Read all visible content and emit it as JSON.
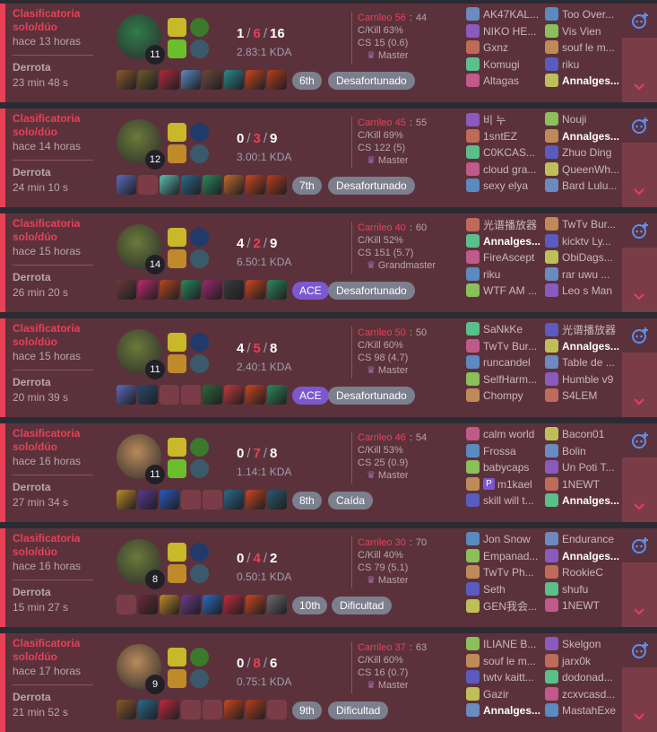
{
  "colors": {
    "loss": "#e84057",
    "loss_bg": "#5b323b",
    "chip": "#7c7f8d",
    "ace": "#7b58d0"
  },
  "matches": [
    {
      "queue": "Clasificatoria solo/dúo",
      "ago": "hace 13 horas",
      "result": "Derrota",
      "duration": "23 min 48 s",
      "level": "11",
      "kills": "1",
      "deaths": "6",
      "assists": "16",
      "kda": "2.83:1 KDA",
      "carry_label": "Carrileo 56",
      "carry_value": "44",
      "ckill": "C/Kill 63%",
      "cs": "CS 15 (0.6)",
      "tier": "Master",
      "place": "6th",
      "badge": "Desafortunado",
      "team1": [
        "AK47KAL...",
        "NIKO HE...",
        "Gxnz",
        "Komugi",
        "Altagas"
      ],
      "team2": [
        "Too Over...",
        "Vis Vien",
        "souf le m...",
        "riku",
        "Annalges..."
      ]
    },
    {
      "queue": "Clasificatoria solo/dúo",
      "ago": "hace 14 horas",
      "result": "Derrota",
      "duration": "24 min 10 s",
      "level": "12",
      "kills": "0",
      "deaths": "3",
      "assists": "9",
      "kda": "3.00:1 KDA",
      "carry_label": "Carrileo 45",
      "carry_value": "55",
      "ckill": "C/Kill 69%",
      "cs": "CS 122 (5)",
      "tier": "Master",
      "place": "7th",
      "badge": "Desafortunado",
      "team1": [
        "비 누",
        "1sntEZ",
        "C0KCAS...",
        "cloud gra...",
        "sexy elya"
      ],
      "team2": [
        "Nouji",
        "Annalges...",
        "Zhuo Ding",
        "QueenWh...",
        "Bard Lulu..."
      ]
    },
    {
      "queue": "Clasificatoria solo/dúo",
      "ago": "hace 15 horas",
      "result": "Derrota",
      "duration": "26 min 20 s",
      "level": "14",
      "kills": "4",
      "deaths": "2",
      "assists": "9",
      "kda": "6.50:1 KDA",
      "carry_label": "Carrileo 40",
      "carry_value": "60",
      "ckill": "C/Kill 52%",
      "cs": "CS 151 (5.7)",
      "tier": "Grandmaster",
      "place": "ACE",
      "badge": "Desafortunado",
      "team1": [
        "光谱播放器",
        "Annalges...",
        "FireAscept",
        "riku",
        "WTF AM ..."
      ],
      "team2": [
        "TwTv Bur...",
        "kicktv Ly...",
        "ObiDags...",
        "rar uwu ...",
        "Leo s Man"
      ]
    },
    {
      "queue": "Clasificatoria solo/dúo",
      "ago": "hace 15 horas",
      "result": "Derrota",
      "duration": "20 min 39 s",
      "level": "11",
      "kills": "4",
      "deaths": "5",
      "assists": "8",
      "kda": "2.40:1 KDA",
      "carry_label": "Carrileo 50",
      "carry_value": "50",
      "ckill": "C/Kill 60%",
      "cs": "CS 98 (4.7)",
      "tier": "Master",
      "place": "ACE",
      "badge": "Desafortunado",
      "team1": [
        "SaNkKe",
        "TwTv Bur...",
        "runcandel",
        "SelfHarm...",
        "Chompy"
      ],
      "team2": [
        "光谱播放器",
        "Annalges...",
        "Table de ...",
        "Humble v9",
        "S4LEM"
      ]
    },
    {
      "queue": "Clasificatoria solo/dúo",
      "ago": "hace 16 horas",
      "result": "Derrota",
      "duration": "27 min 34 s",
      "level": "11",
      "kills": "0",
      "deaths": "7",
      "assists": "8",
      "kda": "1.14:1 KDA",
      "carry_label": "Carrileo 46",
      "carry_value": "54",
      "ckill": "C/Kill 53%",
      "cs": "CS 25 (0.9)",
      "tier": "Master",
      "place": "8th",
      "badge": "Caída",
      "team1": [
        "calm world",
        "Frossa",
        "babycaps",
        "m1kael",
        "skill will t..."
      ],
      "team2": [
        "Bacon01",
        "Bolin",
        "Un Poti T...",
        "1NEWT",
        "Annalges..."
      ]
    },
    {
      "queue": "Clasificatoria solo/dúo",
      "ago": "hace 16 horas",
      "result": "Derrota",
      "duration": "15 min 27 s",
      "level": "8",
      "kills": "0",
      "deaths": "4",
      "assists": "2",
      "kda": "0.50:1 KDA",
      "carry_label": "Carrileo 30",
      "carry_value": "70",
      "ckill": "C/Kill 40%",
      "cs": "CS 79 (5.1)",
      "tier": "Master",
      "place": "10th",
      "badge": "Dificultad",
      "team1": [
        "Jon Snow",
        "Empanad...",
        "TwTv Ph...",
        "Seth",
        "GEN我会..."
      ],
      "team2": [
        "Endurance",
        "Annalges...",
        "RookieC",
        "shufu",
        "1NEWT"
      ]
    },
    {
      "queue": "Clasificatoria solo/dúo",
      "ago": "hace 17 horas",
      "result": "Derrota",
      "duration": "21 min 52 s",
      "level": "9",
      "kills": "0",
      "deaths": "8",
      "assists": "6",
      "kda": "0.75:1 KDA",
      "carry_label": "Carrileo 37",
      "carry_value": "63",
      "ckill": "C/Kill 60%",
      "cs": "CS 16 (0.7)",
      "tier": "Master",
      "place": "9th",
      "badge": "Dificultad",
      "team1": [
        "ILIANE B...",
        "souf le m...",
        "twtv kaitt...",
        "Gazir",
        "Annalges..."
      ],
      "team2": [
        "Skelgon",
        "jarx0k",
        "dodonad...",
        "zcxvcasd...",
        "MastahExe"
      ]
    }
  ],
  "p_badge": "P",
  "carry_sep": ":"
}
